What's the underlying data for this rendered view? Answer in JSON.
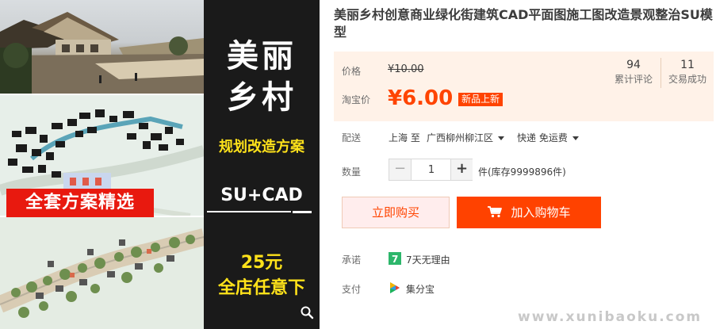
{
  "product": {
    "title": "美丽乡村创意商业绿化街建筑CAD平面图施工图改造景观整治SU模型"
  },
  "promo": {
    "headline": "美丽\n乡村",
    "headline_line1": "美丽",
    "headline_line2": "乡村",
    "subtitle": "规划改造方案",
    "format": "SU+CAD",
    "red_tag": "全套方案精选",
    "price_tag": "25元",
    "store_promo": "全店任意下"
  },
  "price": {
    "list_label": "价格",
    "list_value": "¥10.00",
    "sale_label": "淘宝价",
    "sale_value": "¥6.00",
    "new_badge": "新品上新"
  },
  "stats": [
    {
      "count": "94",
      "label": "累计评论"
    },
    {
      "count": "11",
      "label": "交易成功"
    }
  ],
  "delivery": {
    "label": "配送",
    "from": "上海 至",
    "destination": "广西柳州柳江区",
    "shipping": "快递 免运费"
  },
  "quantity": {
    "label": "数量",
    "value": "1",
    "minus": "−",
    "plus": "+",
    "stock": "件(库存9999896件)"
  },
  "actions": {
    "buy_now": "立即购买",
    "add_to_cart": "加入购物车"
  },
  "promise": {
    "label": "承诺",
    "text": "7天无理由"
  },
  "payment": {
    "label": "支付",
    "text": "集分宝"
  },
  "watermark": "www.xunibaoku.com",
  "colors": {
    "accent": "#ff4400",
    "price_bg": "#fff2e8",
    "banner_bg": "#1a1a1a",
    "banner_yellow": "#ffe21a",
    "red_tag": "#e8190f",
    "promise_green": "#2db66b"
  }
}
